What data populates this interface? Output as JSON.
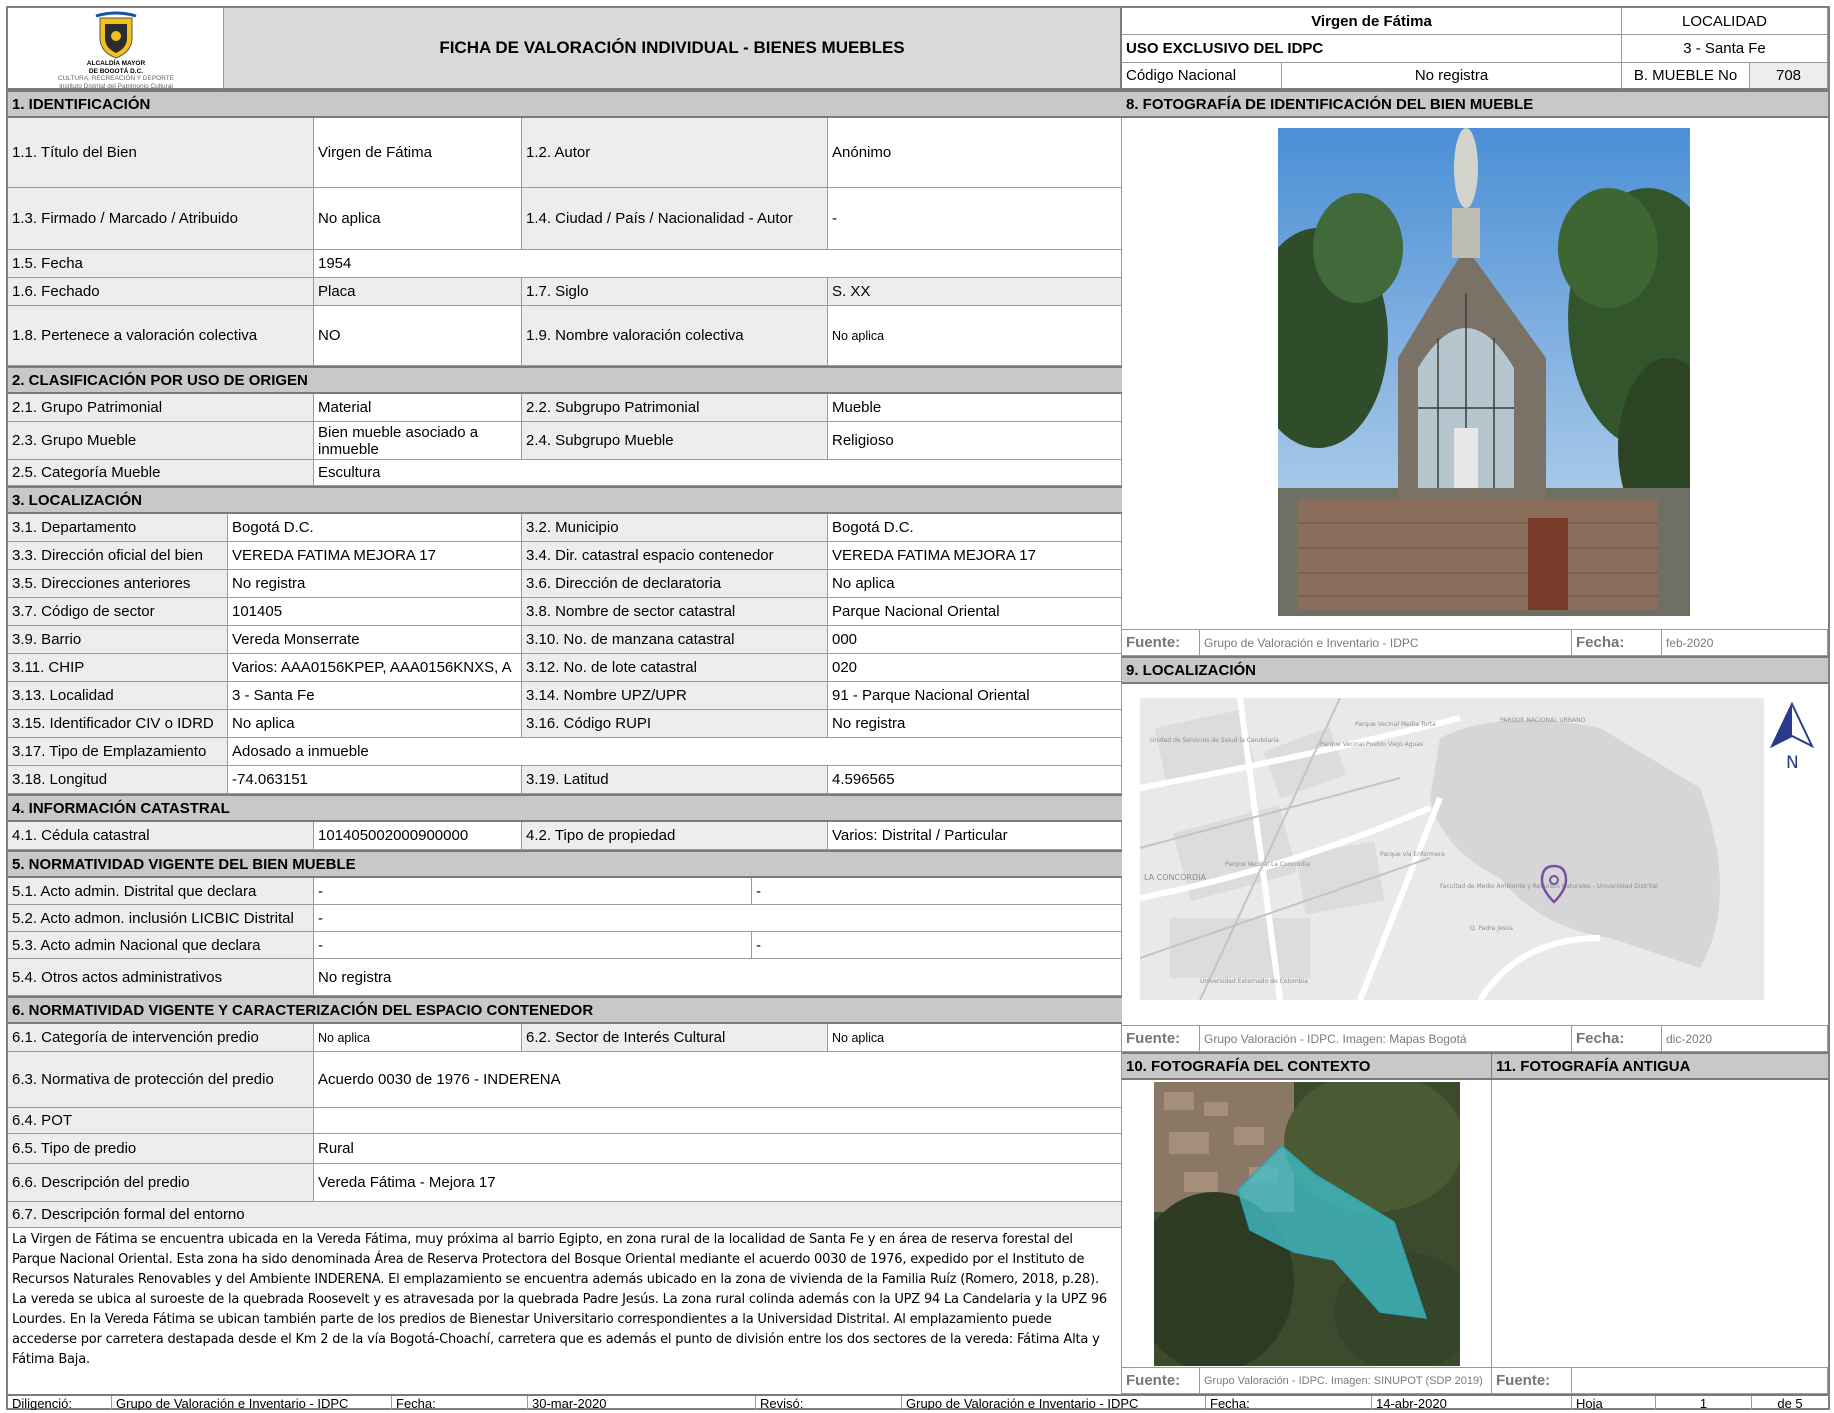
{
  "header": {
    "logo_line1": "ALCALDÍA MAYOR",
    "logo_line2": "DE BOGOTÁ D.C.",
    "logo_line3": "CULTURA, RECREACIÓN Y DEPORTE",
    "logo_line4": "Instituto Distrital del Patrimonio Cultural",
    "title": "FICHA DE VALORACIÓN INDIVIDUAL - BIENES MUEBLES",
    "bien_name": "Virgen de Fátima",
    "localidad_label": "LOCALIDAD",
    "uso_exclusivo": "USO EXCLUSIVO DEL IDPC",
    "localidad_value": "3 - Santa Fe",
    "codigo_nacional_label": "Código Nacional",
    "codigo_nacional_value": "No registra",
    "mueble_no_label": "B. MUEBLE No",
    "mueble_no_value": "708"
  },
  "s1": {
    "title": "1. IDENTIFICACIÓN",
    "rows": [
      {
        "l1": "1.1.  Título del Bien",
        "v1": "Virgen de Fátima",
        "l2": "1.2. Autor",
        "v2": "Anónimo"
      },
      {
        "l1": "1.3. Firmado / Marcado / Atribuido",
        "v1": "No aplica",
        "l2": "1.4. Ciudad / País / Nacionalidad - Autor",
        "v2": "-"
      },
      {
        "l1": "1.5. Fecha",
        "v1": "1954"
      },
      {
        "l1": "1.6. Fechado",
        "v1": "Placa",
        "l2": "1.7. Siglo",
        "v2": "S. XX"
      },
      {
        "l1": "1.8. Pertenece a valoración colectiva",
        "v1": "NO",
        "l2": "1.9. Nombre valoración colectiva",
        "v2": "No aplica"
      }
    ]
  },
  "s2": {
    "title": "2. CLASIFICACIÓN POR USO DE ORIGEN",
    "rows": [
      {
        "l1": "2.1. Grupo Patrimonial",
        "v1": "Material",
        "l2": "2.2. Subgrupo Patrimonial",
        "v2": "Mueble"
      },
      {
        "l1": "2.3. Grupo Mueble",
        "v1": "Bien mueble asociado a inmueble",
        "l2": "2.4. Subgrupo Mueble",
        "v2": "Religioso"
      },
      {
        "l1": "2.5. Categoría Mueble",
        "v1": "Escultura"
      }
    ]
  },
  "s3": {
    "title": "3. LOCALIZACIÓN",
    "rows": [
      {
        "l1": "3.1. Departamento",
        "v1": "Bogotá D.C.",
        "l2": "3.2. Municipio",
        "v2": "Bogotá D.C."
      },
      {
        "l1": "3.3. Dirección oficial del bien",
        "v1": "VEREDA FATIMA MEJORA 17",
        "l2": "3.4. Dir. catastral espacio contenedor",
        "v2": "VEREDA FATIMA MEJORA 17"
      },
      {
        "l1": "3.5. Direcciones anteriores",
        "v1": "No registra",
        "l2": "3.6.  Dirección de declaratoria",
        "v2": "No aplica"
      },
      {
        "l1": "3.7. Código de sector",
        "v1": "101405",
        "l2": "3.8. Nombre de sector catastral",
        "v2": "Parque Nacional Oriental"
      },
      {
        "l1": "3.9. Barrio",
        "v1": "Vereda Monserrate",
        "l2": "3.10. No. de manzana catastral",
        "v2": "000"
      },
      {
        "l1": "3.11. CHIP",
        "v1": "Varios: AAA0156KPEP, AAA0156KNXS, A",
        "l2": "3.12. No. de lote catastral",
        "v2": "020"
      },
      {
        "l1": "3.13. Localidad",
        "v1": "3 - Santa Fe",
        "l2": "3.14.  Nombre UPZ/UPR",
        "v2": "91 - Parque Nacional Oriental"
      },
      {
        "l1": "3.15. Identificador CIV o IDRD",
        "v1": "No aplica",
        "l2": "3.16. Código RUPI",
        "v2": "No registra"
      },
      {
        "l1": "3.17. Tipo de Emplazamiento",
        "v1": "Adosado a inmueble"
      },
      {
        "l1": "3.18. Longitud",
        "v1": "-74.063151",
        "l2": "3.19. Latitud",
        "v2": "4.596565"
      }
    ]
  },
  "s4": {
    "title": "4. INFORMACIÓN CATASTRAL",
    "rows": [
      {
        "l1": "4.1. Cédula catastral",
        "v1": "101405002000900000",
        "l2": "4.2. Tipo de propiedad",
        "v2": "Varios: Distrital / Particular"
      }
    ]
  },
  "s5": {
    "title": "5. NORMATIVIDAD VIGENTE DEL BIEN MUEBLE",
    "rows": [
      {
        "l1": "5.1. Acto admin. Distrital que declara",
        "v1": "-",
        "v2": "-"
      },
      {
        "l1": "5.2. Acto admon. inclusión LICBIC Distrital",
        "v1": "-"
      },
      {
        "l1": "5.3. Acto admin Nacional que declara",
        "v1": "-",
        "v2": "-"
      },
      {
        "l1": "5.4. Otros actos administrativos",
        "v1": "No registra"
      }
    ]
  },
  "s6": {
    "title": "6. NORMATIVIDAD VIGENTE Y CARACTERIZACIÓN DEL ESPACIO CONTENEDOR",
    "rows": [
      {
        "l1": "6.1. Categoría de intervención predio",
        "v1": "No aplica",
        "l2": "6.2. Sector de Interés Cultural",
        "v2": "No aplica"
      },
      {
        "l1": "6.3. Normativa de protección del predio",
        "v1": "Acuerdo 0030 de 1976 - INDERENA"
      },
      {
        "l1": "6.4. POT",
        "v1": ""
      },
      {
        "l1": "6.5. Tipo de predio",
        "v1": "Rural"
      },
      {
        "l1": "6.6. Descripción del predio",
        "v1": "Vereda Fátima - Mejora 17"
      }
    ],
    "entorno_label": "6.7. Descripción formal del entorno",
    "entorno_text": "La Virgen de Fátima se encuentra ubicada en la Vereda Fátima, muy próxima al barrio Egipto, en zona rural de la localidad de Santa Fe y en área de reserva forestal del Parque Nacional Oriental. Esta zona ha sido denominada Área de Reserva Protectora del Bosque Oriental mediante el acuerdo 0030 de 1976, expedido por el Instituto de Recursos Naturales Renovables y del Ambiente INDERENA. El emplazamiento se encuentra además ubicado en la zona de vivienda de la Familia Ruíz (Romero, 2018, p.28). La vereda se ubica al suroeste de la quebrada Roosevelt y es atravesada por la quebrada Padre Jesús. La zona rural colinda además con la UPZ 94 La Candelaria y la UPZ 96 Lourdes. En la Vereda Fátima se ubican también parte de los predios de Bienestar Universitario correspondientes a la Universidad Distrital. Al emplazamiento puede accederse por carretera destapada desde el Km 2 de la vía Bogotá-Choachí, carretera que es además el punto de división entre los dos sectores de la vereda: Fátima Alta y Fátima Baja."
  },
  "s8": {
    "title": "8. FOTOGRAFÍA DE IDENTIFICACIÓN DEL BIEN MUEBLE",
    "fuente_label": "Fuente:",
    "fuente_value": "Grupo de Valoración e Inventario - IDPC",
    "fecha_label": "Fecha:",
    "fecha_value": "feb-2020"
  },
  "s9": {
    "title": "9. LOCALIZACIÓN",
    "north_label": "N",
    "map_labels": [
      "PARQUE NACIONAL URBANO",
      "Parque Vecinal Media Torta",
      "Unidad de Servicios de Salud la Candelaria",
      "Parque Vecinal Pueblo Viejo Aguas",
      "Parque Vecinal La Concordia",
      "LA CONCORDIA",
      "Parque vía Enfermera",
      "Facultad de Medio Ambiente y Recursos Naturales - Universidad Distrital",
      "Q. Padre Jesús",
      "Universidad Externado de Colombia"
    ],
    "fuente_label": "Fuente:",
    "fuente_value": "Grupo Valoración - IDPC. Imagen: Mapas Bogotá",
    "fecha_label": "Fecha:",
    "fecha_value": "dic-2020"
  },
  "s10": {
    "title": "10. FOTOGRAFÍA DEL CONTEXTO",
    "fuente_label": "Fuente:",
    "fuente_value": "Grupo Valoración - IDPC. Imagen: SINUPOT (SDP 2019)"
  },
  "s11": {
    "title": "11. FOTOGRAFÍA ANTIGUA",
    "fuente_label": "Fuente:",
    "fuente_value": ""
  },
  "footer": {
    "diligencio_label": "Diligenció:",
    "diligencio_value": "Grupo de Valoración e Inventario - IDPC",
    "fecha1_label": "Fecha:",
    "fecha1_value": "30-mar-2020",
    "reviso_label": "Revisó:",
    "reviso_value": "Grupo de Valoración e Inventario - IDPC",
    "fecha2_label": "Fecha:",
    "fecha2_value": "14-abr-2020",
    "hoja_label": "Hoja",
    "hoja_value": "1",
    "de_label": "de 5"
  },
  "colors": {
    "section_bg": "#c8c8c8",
    "label_bg": "#ededed",
    "border": "#9a9a9a",
    "map_route": "#ffffff",
    "polygon_fill": "#3fc3d0",
    "pin": "#7b4fa3"
  }
}
